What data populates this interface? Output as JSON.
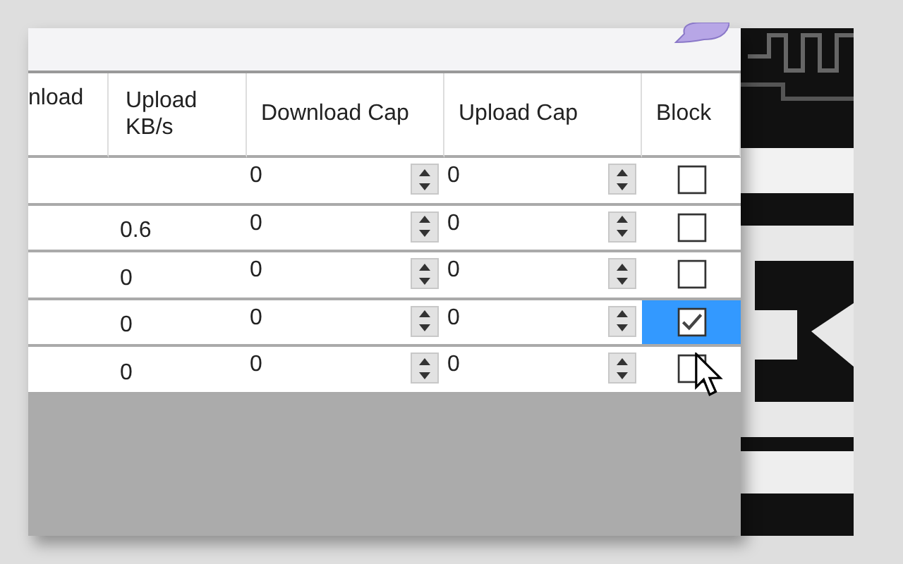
{
  "table": {
    "columns": [
      "nload",
      "Upload\nKB/s",
      "Download Cap",
      "Upload Cap",
      "Block"
    ],
    "rows": [
      {
        "column_1": "",
        "upload": "",
        "download_cap": "0",
        "upload_cap": "0",
        "block": false,
        "selected": false
      },
      {
        "column_1": "",
        "upload": "0.6",
        "download_cap": "0",
        "upload_cap": "0",
        "block": false,
        "selected": false
      },
      {
        "column_1": "",
        "upload": "0",
        "download_cap": "0",
        "upload_cap": "0",
        "block": false,
        "selected": false
      },
      {
        "column_1": "",
        "upload": "0",
        "download_cap": "0",
        "upload_cap": "0",
        "block": true,
        "selected": true
      },
      {
        "column_1": "",
        "upload": "0",
        "download_cap": "0",
        "upload_cap": "0",
        "block": false,
        "selected": false
      }
    ]
  }
}
